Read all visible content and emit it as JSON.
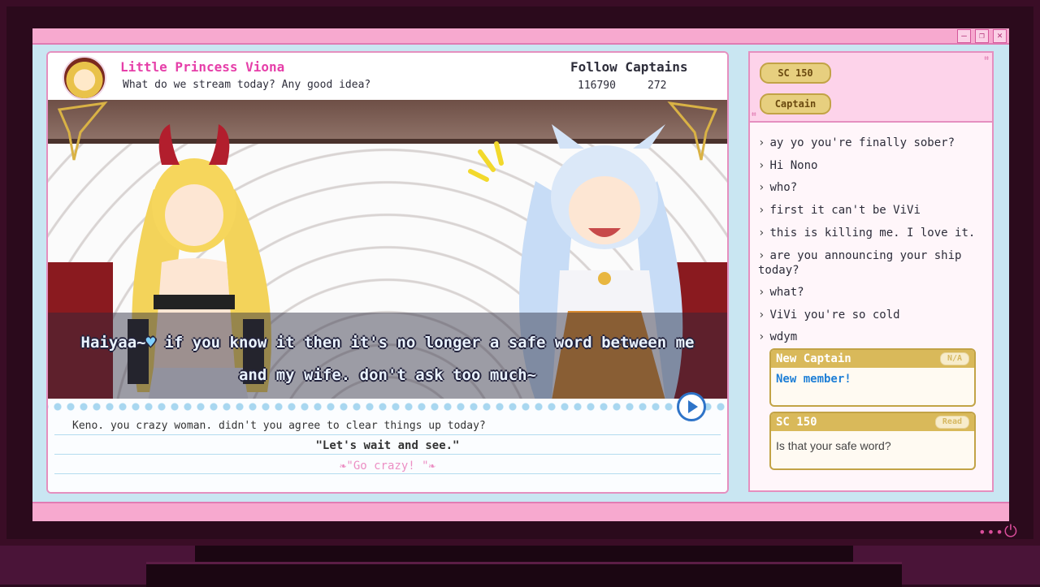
{
  "window": {
    "minimize_glyph": "–",
    "restore_glyph": "❐",
    "close_glyph": "✕"
  },
  "header": {
    "streamer_name": "Little Princess Viona",
    "stream_description": "What do we stream today?  Any good idea?",
    "follow_title": "Follow Captains",
    "follow_count_1": "116790",
    "follow_count_2": "272"
  },
  "subtitle": {
    "line1_prefix": "Haiyaa~",
    "line1_heart": "♥",
    "line1_rest": " if you know it then it's no longer a safe word between me",
    "line2": "and my wife.  don't ask too much~"
  },
  "dialog": {
    "line1": "Keno.  you crazy woman.  didn't you agree to clear things up today?",
    "line2": "\"Let's wait and see.\"",
    "line3": "❧\"Go crazy! \"❧"
  },
  "chat": {
    "pills": [
      "SC 150",
      "Captain"
    ],
    "messages": [
      "ay yo you're finally sober?",
      "Hi Nono",
      "who?",
      "first it can't be ViVi",
      "this is killing me.  I love it.",
      "are you announcing your ship today?",
      "what?",
      "ViVi you're so cold",
      "wdym"
    ],
    "cards": [
      {
        "title": "New Captain",
        "tag": "N/A",
        "body": "New member!"
      },
      {
        "title": "SC 150",
        "tag": "Read",
        "body": "Is that your safe word?"
      }
    ]
  },
  "colors": {
    "accent_pink": "#e63fa9",
    "window_pink": "#f7a9cf",
    "window_blue": "#c9e6f2",
    "gold": "#d9b95a",
    "new_member_blue": "#1f7fd6"
  }
}
